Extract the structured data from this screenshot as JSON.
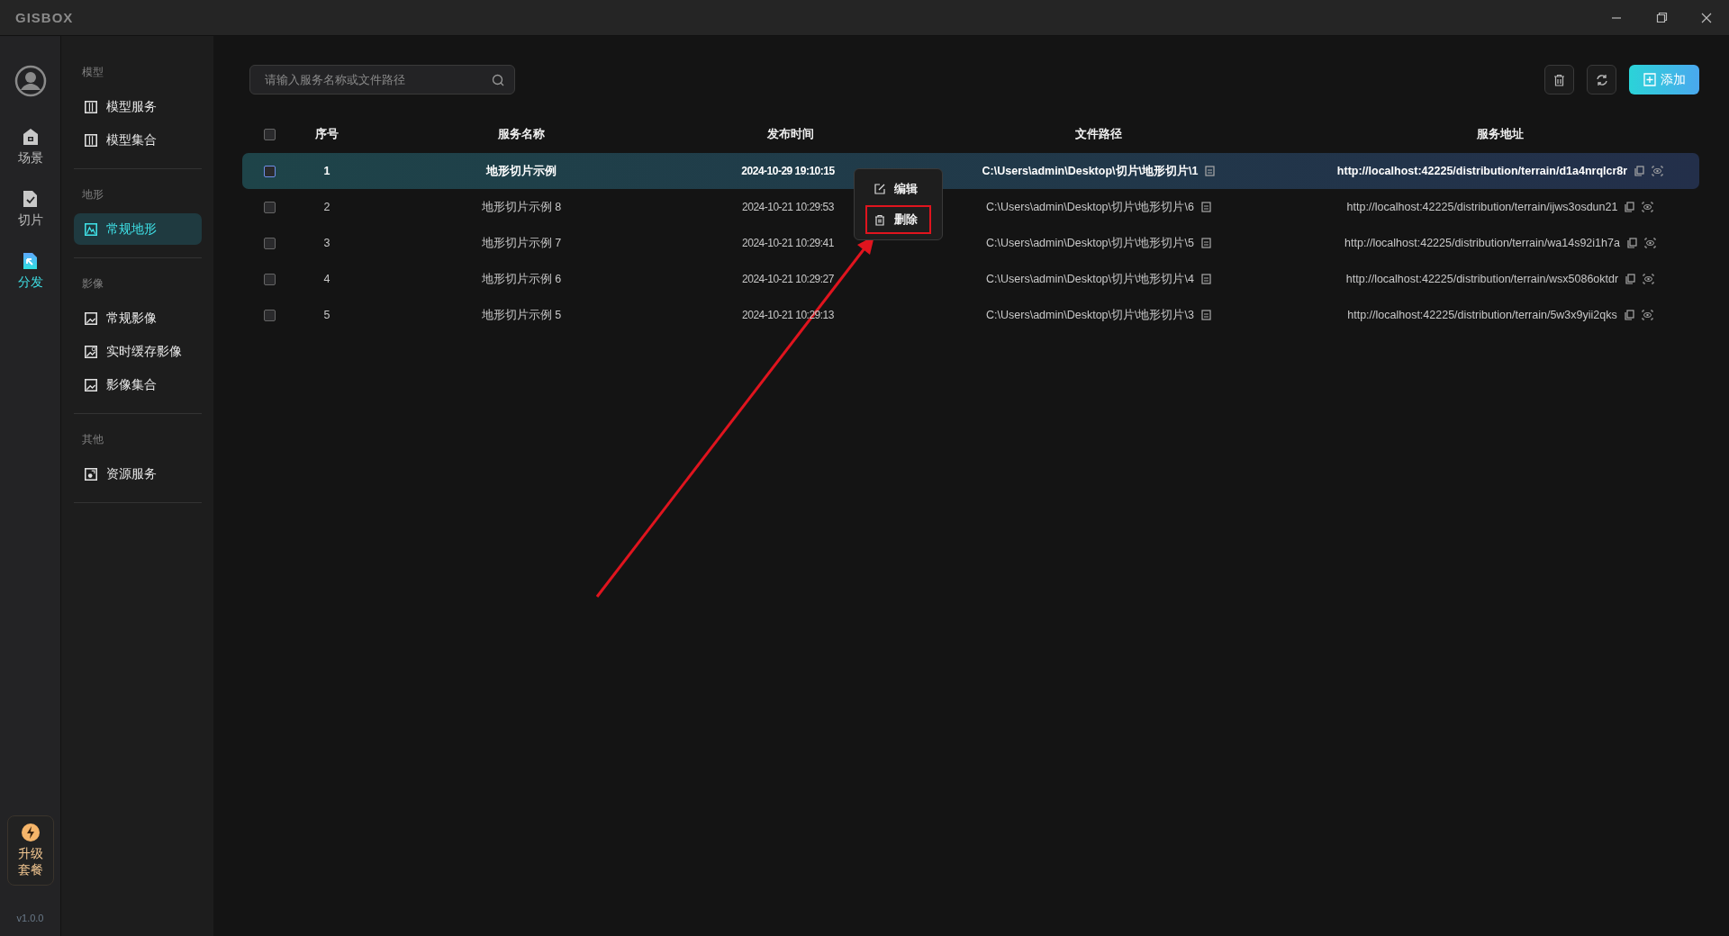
{
  "window": {
    "logo": "GISBOX"
  },
  "rail": {
    "items": [
      {
        "label": "场景",
        "selected": false
      },
      {
        "label": "切片",
        "selected": false
      },
      {
        "label": "分发",
        "selected": true
      }
    ],
    "upgrade": "升级套餐",
    "version": "v1.0.0"
  },
  "nav": {
    "groups": [
      {
        "title": "模型",
        "items": [
          {
            "label": "模型服务",
            "selected": false
          },
          {
            "label": "模型集合",
            "selected": false
          }
        ]
      },
      {
        "title": "地形",
        "items": [
          {
            "label": "常规地形",
            "selected": true
          }
        ]
      },
      {
        "title": "影像",
        "items": [
          {
            "label": "常规影像",
            "selected": false
          },
          {
            "label": "实时缓存影像",
            "selected": false
          },
          {
            "label": "影像集合",
            "selected": false
          }
        ]
      },
      {
        "title": "其他",
        "items": [
          {
            "label": "资源服务",
            "selected": false
          }
        ]
      }
    ]
  },
  "toolbar": {
    "search": {
      "placeholder": "请输入服务名称或文件路径"
    },
    "add_button": "添加"
  },
  "table": {
    "columns": [
      "序号",
      "服务名称",
      "发布时间",
      "文件路径",
      "服务地址"
    ],
    "all_checked": false,
    "rows": [
      {
        "index": "1",
        "name": "地形切片示例",
        "time": "2024-10-29 19:10:15",
        "path": "C:\\Users\\admin\\Desktop\\切片\\地形切片\\1",
        "url": "http://localhost:42225/distribution/terrain/d1a4nrqlcr8r",
        "selected": true,
        "checked": false
      },
      {
        "index": "2",
        "name": "地形切片示例 8",
        "time": "2024-10-21 10:29:53",
        "path": "C:\\Users\\admin\\Desktop\\切片\\地形切片\\6",
        "url": "http://localhost:42225/distribution/terrain/ijws3osdun21",
        "selected": false,
        "checked": false
      },
      {
        "index": "3",
        "name": "地形切片示例 7",
        "time": "2024-10-21 10:29:41",
        "path": "C:\\Users\\admin\\Desktop\\切片\\地形切片\\5",
        "url": "http://localhost:42225/distribution/terrain/wa14s92i1h7a",
        "selected": false,
        "checked": false
      },
      {
        "index": "4",
        "name": "地形切片示例 6",
        "time": "2024-10-21 10:29:27",
        "path": "C:\\Users\\admin\\Desktop\\切片\\地形切片\\4",
        "url": "http://localhost:42225/distribution/terrain/wsx5086oktdr",
        "selected": false,
        "checked": false
      },
      {
        "index": "5",
        "name": "地形切片示例 5",
        "time": "2024-10-21 10:29:13",
        "path": "C:\\Users\\admin\\Desktop\\切片\\地形切片\\3",
        "url": "http://localhost:42225/distribution/terrain/5w3x9yii2qks",
        "selected": false,
        "checked": false
      }
    ]
  },
  "context_menu": {
    "items": [
      {
        "kind": "edit",
        "label": "编辑",
        "highlighted": false
      },
      {
        "kind": "delete",
        "label": "删除",
        "highlighted": true
      }
    ]
  }
}
